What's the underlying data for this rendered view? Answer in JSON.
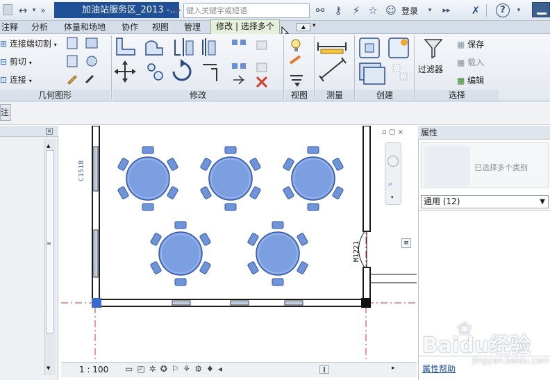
{
  "window": {
    "document_title": "加油站服务区_2013 -...",
    "search_placeholder": "键入关键字或短语",
    "login_label": "登录",
    "arrows": "↔",
    "more": "»"
  },
  "tabs": [
    {
      "label": "注释"
    },
    {
      "label": "分析"
    },
    {
      "label": "体量和场地"
    },
    {
      "label": "协作"
    },
    {
      "label": "视图"
    },
    {
      "label": "管理"
    },
    {
      "label": "修改 | 选择多个"
    }
  ],
  "ribbon": {
    "geometry": {
      "items": [
        "连接端切割",
        "剪切",
        "连接"
      ],
      "panel_label": "几何图形"
    },
    "modify": {
      "panel_label": "修改"
    },
    "view": {
      "panel_label": "视图"
    },
    "measure": {
      "panel_label": "测量"
    },
    "create": {
      "panel_label": "创建"
    },
    "select": {
      "filter_label": "过滤器",
      "save_label": "保存",
      "load_label": "载入",
      "edit_label": "编辑",
      "panel_label": "选择"
    }
  },
  "options_bar": {
    "label": "注"
  },
  "canvas": {
    "window_tag_left": "C1518",
    "window_tag_right": "M1221",
    "scale": "1 : 100",
    "accent_color": "#6f94d8",
    "wall_color": "#1a1a1a",
    "gridline_color": "#cc3333"
  },
  "properties": {
    "title": "属性",
    "type_text": "已选择多个类别",
    "selector": "通用 (12)",
    "help_link": "属性帮助"
  },
  "watermark": {
    "brand": "Baidu经验",
    "sub": "jingyan.baidu.com"
  }
}
